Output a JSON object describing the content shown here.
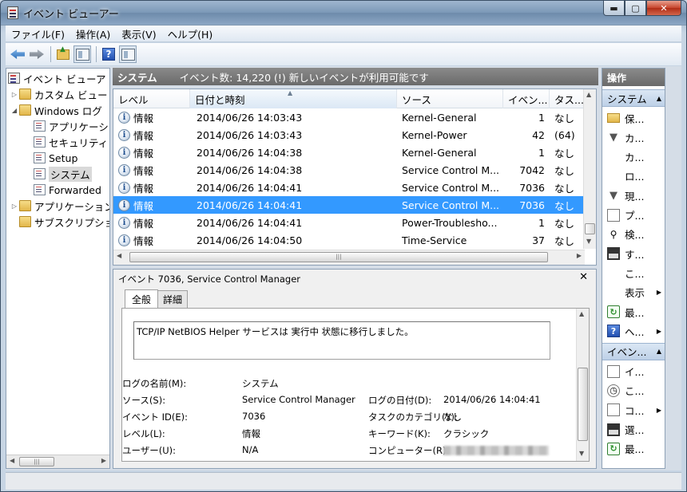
{
  "window": {
    "title": "イベント ビューアー",
    "min_glyph": "▬",
    "max_glyph": "▢",
    "close_glyph": "✕"
  },
  "menu": [
    "ファイル(F)",
    "操作(A)",
    "表示(V)",
    "ヘルプ(H)"
  ],
  "toolbar": {
    "icons": [
      "back-arrow-icon",
      "forward-arrow-icon",
      "folder-up-icon",
      "show-hide-tree-icon",
      "help-icon",
      "show-hide-action-pane-icon"
    ],
    "help_glyph": "?"
  },
  "tree": {
    "items": [
      {
        "label": "イベント ビューア",
        "expander": "",
        "icon": "event-viewer-icon"
      },
      {
        "label": "カスタム ビュー",
        "expander": "▷",
        "icon": "folder-icon"
      },
      {
        "label": "Windows ログ",
        "expander": "◢",
        "icon": "folder-icon"
      },
      {
        "label": "アプリケーション",
        "expander": "",
        "icon": "log-icon"
      },
      {
        "label": "セキュリティ",
        "expander": "",
        "icon": "log-icon"
      },
      {
        "label": "Setup",
        "expander": "",
        "icon": "log-icon"
      },
      {
        "label": "システム",
        "expander": "",
        "icon": "log-icon"
      },
      {
        "label": "Forwarded",
        "expander": "",
        "icon": "log-icon"
      },
      {
        "label": "アプリケーション",
        "expander": "▷",
        "icon": "folder-icon"
      },
      {
        "label": "サブスクリプション",
        "expander": "",
        "icon": "folder-icon"
      }
    ],
    "selected_index": 6,
    "scroll_left": "◀",
    "scroll_right": "▶",
    "thumb_grip": "|||"
  },
  "center": {
    "header_title": "システム",
    "header_info": "イベント数: 14,220 (!) 新しいイベントが利用可能です"
  },
  "grid": {
    "columns": [
      "レベル",
      "日付と時刻",
      "ソース",
      "イベン...",
      "タス..."
    ],
    "sort_caret": "▲",
    "info_glyph": "i",
    "rows": [
      {
        "level": "情報",
        "datetime": "2014/06/26 14:03:43",
        "source": "Kernel-General",
        "event_id": "1",
        "task": "なし"
      },
      {
        "level": "情報",
        "datetime": "2014/06/26 14:03:43",
        "source": "Kernel-Power",
        "event_id": "42",
        "task": "(64)"
      },
      {
        "level": "情報",
        "datetime": "2014/06/26 14:04:38",
        "source": "Kernel-General",
        "event_id": "1",
        "task": "なし"
      },
      {
        "level": "情報",
        "datetime": "2014/06/26 14:04:38",
        "source": "Service Control M...",
        "event_id": "7042",
        "task": "なし"
      },
      {
        "level": "情報",
        "datetime": "2014/06/26 14:04:41",
        "source": "Service Control M...",
        "event_id": "7036",
        "task": "なし"
      },
      {
        "level": "情報",
        "datetime": "2014/06/26 14:04:41",
        "source": "Service Control M...",
        "event_id": "7036",
        "task": "なし"
      },
      {
        "level": "情報",
        "datetime": "2014/06/26 14:04:41",
        "source": "Power-Troublesho...",
        "event_id": "1",
        "task": "なし"
      },
      {
        "level": "情報",
        "datetime": "2014/06/26 14:04:50",
        "source": "Time-Service",
        "event_id": "37",
        "task": "なし"
      }
    ],
    "selected_index": 5,
    "scroll_up": "▲",
    "scroll_down": "▼",
    "scroll_left": "◀",
    "scroll_right": "▶",
    "thumb_grip": "|||"
  },
  "detail": {
    "title": "イベント 7036, Service Control Manager",
    "close_glyph": "✕",
    "tabs": [
      "全般",
      "詳細"
    ],
    "active_tab": 0,
    "message": "TCP/IP NetBIOS Helper サービスは 実行中 状態に移行しました。",
    "fields_left": [
      {
        "label": "ログの名前(M):",
        "value": "システム"
      },
      {
        "label": "ソース(S):",
        "value": "Service Control Manager"
      },
      {
        "label": "イベント ID(E):",
        "value": "7036"
      },
      {
        "label": "レベル(L):",
        "value": "情報"
      },
      {
        "label": "ユーザー(U):",
        "value": "N/A"
      }
    ],
    "fields_right": [
      {
        "label": "ログの日付(D):",
        "value": "2014/06/26 14:04:41"
      },
      {
        "label": "タスクのカテゴリ(Y):",
        "value": "なし"
      },
      {
        "label": "キーワード(K):",
        "value": "クラシック"
      },
      {
        "label": "コンピューター(R):",
        "value": ""
      }
    ],
    "scroll_up": "▲",
    "scroll_down": "▼"
  },
  "actions": {
    "title": "操作",
    "sections": [
      {
        "title": "システム",
        "caret": "▲",
        "items": [
          {
            "label": "保...",
            "icon": "open-log-icon",
            "glyph": "",
            "submenu": ""
          },
          {
            "label": "カ...",
            "icon": "filter-icon",
            "glyph": "▼",
            "submenu": ""
          },
          {
            "label": "カ...",
            "icon": "",
            "glyph": "",
            "submenu": ""
          },
          {
            "label": "ロ...",
            "icon": "",
            "glyph": "",
            "submenu": ""
          },
          {
            "label": "現...",
            "icon": "filter-icon",
            "glyph": "▼",
            "submenu": ""
          },
          {
            "label": "プ...",
            "icon": "properties-icon",
            "glyph": "",
            "submenu": ""
          },
          {
            "label": "検...",
            "icon": "find-icon",
            "glyph": "⚲",
            "submenu": ""
          },
          {
            "label": "す...",
            "icon": "save-icon",
            "glyph": "",
            "submenu": ""
          },
          {
            "label": "こ...",
            "icon": "",
            "glyph": "",
            "submenu": ""
          },
          {
            "label": "表示",
            "icon": "",
            "glyph": "",
            "submenu": "▶"
          },
          {
            "label": "最...",
            "icon": "refresh-icon",
            "glyph": "↻",
            "submenu": ""
          },
          {
            "label": "ヘ...",
            "icon": "help-icon",
            "glyph": "?",
            "submenu": "▶"
          }
        ]
      },
      {
        "title": "イベン...",
        "caret": "▲",
        "items": [
          {
            "label": "イ...",
            "icon": "event-properties-icon",
            "glyph": "",
            "submenu": ""
          },
          {
            "label": "こ...",
            "icon": "attach-task-icon",
            "glyph": "◷",
            "submenu": ""
          },
          {
            "label": "コ...",
            "icon": "copy-icon",
            "glyph": "",
            "submenu": "▶"
          },
          {
            "label": "選...",
            "icon": "save-icon",
            "glyph": "",
            "submenu": ""
          },
          {
            "label": "最...",
            "icon": "refresh-icon",
            "glyph": "↻",
            "submenu": ""
          }
        ]
      }
    ]
  }
}
